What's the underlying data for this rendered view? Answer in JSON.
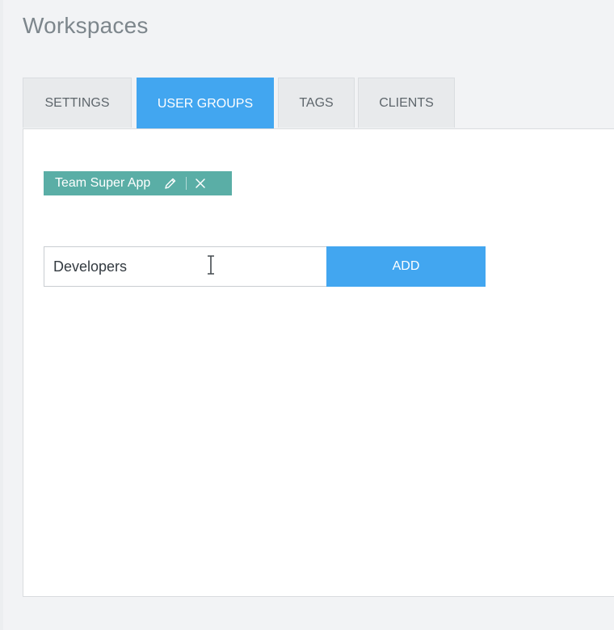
{
  "page": {
    "title": "Workspaces"
  },
  "tabs": [
    {
      "label": "SETTINGS",
      "active": false
    },
    {
      "label": "USER GROUPS",
      "active": true
    },
    {
      "label": "TAGS",
      "active": false
    },
    {
      "label": "CLIENTS",
      "active": false
    }
  ],
  "user_groups": {
    "chips": [
      {
        "label": "Team Super App",
        "edit_icon": "pencil-icon",
        "remove_icon": "close-icon"
      }
    ],
    "new_group_input": {
      "value": "Developers",
      "placeholder": ""
    },
    "add_button_label": "ADD"
  },
  "colors": {
    "accent": "#42a6f0",
    "chip": "#5aaea6",
    "title_text": "#7d868c",
    "tab_inactive_bg": "#e8eaec"
  }
}
